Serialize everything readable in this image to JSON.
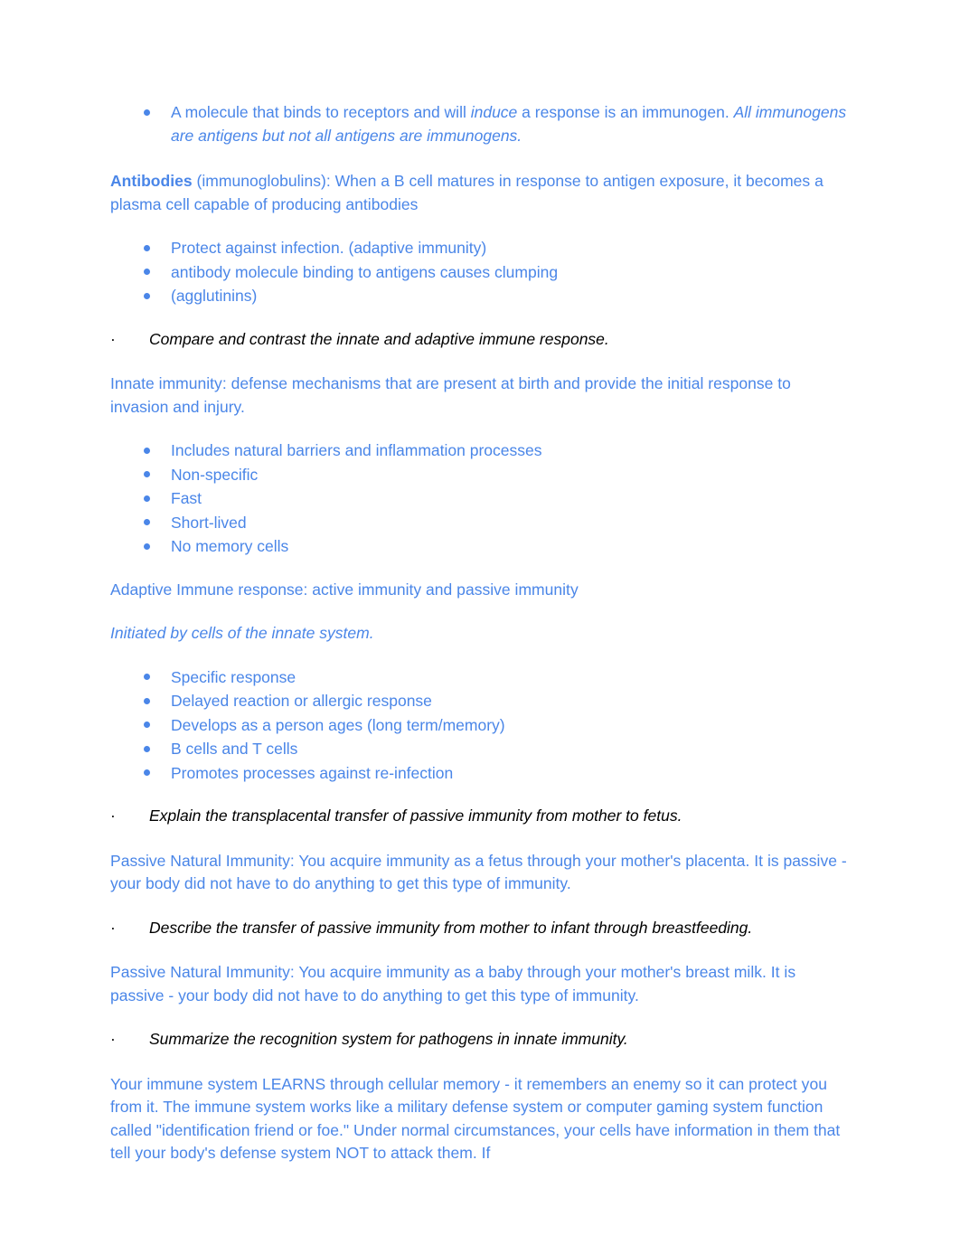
{
  "document": {
    "colors": {
      "body_blue": "#4a86e8",
      "objective_black": "#000000",
      "page_background": "#ffffff"
    },
    "bullet_glyph": "filled-circle",
    "objective_glyph": "middle-dot",
    "objective_marker": "·"
  },
  "blocks": {
    "immunogen_bullet": {
      "text_part1": "A molecule that binds to receptors and will ",
      "italic_induce": "induce",
      "text_part2": " a response is an immunogen. ",
      "italic_tail": "All immunogens are antigens but not all antigens are immunogens."
    },
    "antibodies_para": {
      "bold_lead": "Antibodies",
      "rest": " (immunoglobulins): When a B cell matures in response to antigen exposure, it becomes a plasma cell capable of producing antibodies"
    },
    "antibodies_bullets": [
      "Protect against infection. (adaptive immunity)",
      " antibody molecule binding to antigens causes clumping",
      "(agglutinins)"
    ],
    "objective_compare": "Compare and contrast the innate and adaptive immune response.",
    "innate_para": "Innate immunity: defense mechanisms that are present at birth and provide the initial response to invasion and injury.",
    "innate_bullets": [
      "Includes natural barriers and inflammation processes",
      "Non-specific",
      "Fast",
      "Short-lived",
      "No memory cells"
    ],
    "adaptive_para": "Adaptive Immune response: active immunity and passive immunity",
    "adaptive_italic_para": "Initiated by cells of the innate system.",
    "adaptive_bullets": [
      "Specific response",
      "Delayed reaction or allergic response",
      "Develops as a person ages (long term/memory)",
      "B cells and T cells",
      "Promotes processes against re-infection"
    ],
    "objective_transplacental": "Explain the transplacental transfer of passive immunity from mother to fetus.",
    "passive_fetus_para": "Passive Natural Immunity: You acquire immunity as a fetus through your mother's placenta. It is passive - your body did not have to do anything to get this type of immunity.",
    "objective_breastfeeding": "Describe the transfer of passive immunity from mother to infant through breastfeeding.",
    "passive_baby_para": "Passive Natural Immunity: You acquire immunity as a baby through your mother's breast milk. It is passive - your body did not have to do anything to get this type of immunity.",
    "objective_recognition": "Summarize the recognition system for pathogens in innate immunity.",
    "learns_para": "Your immune system LEARNS through cellular memory - it remembers an enemy so it can protect you from it. The immune system works like a military defense system or computer gaming system function called \"identification friend or foe.\" Under normal circumstances, your cells have information in them that tell your body's defense system NOT to attack them. If"
  }
}
